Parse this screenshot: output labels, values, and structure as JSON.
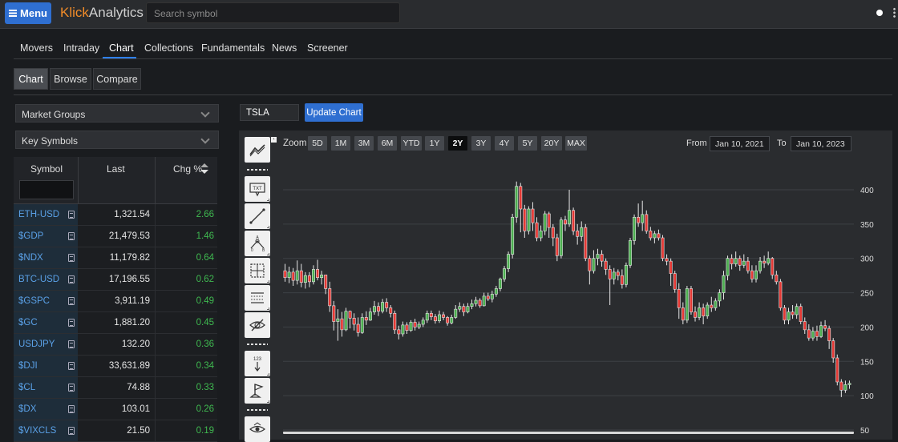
{
  "topbar": {
    "menu_label": "Menu",
    "logo_part1": "Klick",
    "logo_part2": "Analytics",
    "search_placeholder": "Search symbol"
  },
  "nav": {
    "tabs": [
      "Movers",
      "Intraday",
      "Chart",
      "Collections",
      "Fundamentals",
      "News",
      "Screener"
    ],
    "active": "Chart"
  },
  "subtabs": {
    "items": [
      "Chart",
      "Browse",
      "Compare"
    ],
    "active": "Chart"
  },
  "sidebar": {
    "market_groups": "Market Groups",
    "key_symbols": "Key Symbols",
    "columns": {
      "symbol": "Symbol",
      "last": "Last",
      "chg": "Chg %"
    },
    "rows": [
      {
        "symbol": "ETH-USD",
        "last": "1,321.54",
        "chg": "2.66"
      },
      {
        "symbol": "$GDP",
        "last": "21,479.53",
        "chg": "1.46"
      },
      {
        "symbol": "$NDX",
        "last": "11,179.82",
        "chg": "0.64"
      },
      {
        "symbol": "BTC-USD",
        "last": "17,196.55",
        "chg": "0.62"
      },
      {
        "symbol": "$GSPC",
        "last": "3,911.19",
        "chg": "0.49"
      },
      {
        "symbol": "$GC",
        "last": "1,881.20",
        "chg": "0.45"
      },
      {
        "symbol": "USDJPY",
        "last": "132.20",
        "chg": "0.36"
      },
      {
        "symbol": "$DJI",
        "last": "33,631.89",
        "chg": "0.34"
      },
      {
        "symbol": "$CL",
        "last": "74.88",
        "chg": "0.33"
      },
      {
        "symbol": "$DX",
        "last": "103.01",
        "chg": "0.26"
      },
      {
        "symbol": "$VIXCLS",
        "last": "21.50",
        "chg": "0.19"
      }
    ],
    "positive_color": "#3fb950"
  },
  "chart_controls": {
    "ticker": "TSLA",
    "update_label": "Update Chart",
    "zoom_label": "Zoom",
    "zoom_options": [
      "5D",
      "1M",
      "3M",
      "6M",
      "YTD",
      "1Y",
      "2Y",
      "3Y",
      "4Y",
      "5Y",
      "20Y",
      "MAX"
    ],
    "zoom_active": "2Y",
    "from_label": "From",
    "from_date": "Jan 10, 2021",
    "to_label": "To",
    "to_date": "Jan 10, 2023"
  },
  "tools": [
    "chart-style-icon",
    "text-annotation-icon",
    "trend-line-icon",
    "abcd-pattern-icon",
    "crosshair-box-icon",
    "fibonacci-icon",
    "hide-drawings-icon",
    "price-label-icon",
    "flag-marker-icon",
    "eye-pan-icon"
  ],
  "chart_data": {
    "type": "candlestick",
    "symbol": "TSLA",
    "ylim": [
      50,
      420
    ],
    "yticks": [
      400,
      350,
      300,
      250,
      200,
      150,
      100,
      50
    ],
    "up_color": "#4caf50",
    "down_color": "#e53935",
    "candles": [
      [
        282,
        272,
        292,
        266
      ],
      [
        272,
        280,
        288,
        264
      ],
      [
        280,
        268,
        286,
        260
      ],
      [
        268,
        282,
        297,
        262
      ],
      [
        282,
        265,
        292,
        258
      ],
      [
        265,
        275,
        280,
        256
      ],
      [
        275,
        266,
        280,
        258
      ],
      [
        266,
        284,
        290,
        262
      ],
      [
        284,
        272,
        298,
        268
      ],
      [
        272,
        276,
        282,
        262
      ],
      [
        276,
        256,
        274,
        248
      ],
      [
        256,
        231,
        266,
        222
      ],
      [
        231,
        208,
        238,
        195
      ],
      [
        208,
        212,
        226,
        180
      ],
      [
        212,
        196,
        222,
        186
      ],
      [
        196,
        223,
        228,
        194
      ],
      [
        223,
        213,
        224,
        198
      ],
      [
        213,
        204,
        220,
        195
      ],
      [
        204,
        192,
        214,
        186
      ],
      [
        192,
        214,
        220,
        190
      ],
      [
        214,
        210,
        223,
        203
      ],
      [
        210,
        222,
        228,
        209
      ],
      [
        222,
        230,
        238,
        218
      ],
      [
        230,
        223,
        236,
        216
      ],
      [
        223,
        236,
        241,
        220
      ],
      [
        236,
        228,
        242,
        222
      ],
      [
        228,
        220,
        232,
        214
      ],
      [
        220,
        196,
        224,
        190
      ],
      [
        196,
        190,
        202,
        182
      ],
      [
        190,
        203,
        208,
        186
      ],
      [
        203,
        195,
        207,
        190
      ],
      [
        195,
        207,
        210,
        193
      ],
      [
        207,
        200,
        212,
        195
      ],
      [
        200,
        204,
        208,
        197
      ],
      [
        204,
        210,
        214,
        200
      ],
      [
        210,
        220,
        224,
        206
      ],
      [
        220,
        215,
        224,
        210
      ],
      [
        215,
        209,
        219,
        205
      ],
      [
        209,
        218,
        224,
        206
      ],
      [
        218,
        214,
        222,
        210
      ],
      [
        214,
        206,
        216,
        202
      ],
      [
        206,
        214,
        218,
        204
      ],
      [
        214,
        226,
        232,
        212
      ],
      [
        226,
        230,
        236,
        222
      ],
      [
        230,
        222,
        234,
        216
      ],
      [
        222,
        230,
        235,
        220
      ],
      [
        230,
        234,
        240,
        226
      ],
      [
        234,
        239,
        244,
        230
      ],
      [
        239,
        231,
        242,
        228
      ],
      [
        231,
        245,
        250,
        230
      ],
      [
        245,
        241,
        250,
        238
      ],
      [
        241,
        248,
        253,
        236
      ],
      [
        248,
        256,
        260,
        244
      ],
      [
        256,
        270,
        272,
        252
      ],
      [
        270,
        285,
        289,
        266
      ],
      [
        285,
        306,
        310,
        280
      ],
      [
        306,
        360,
        365,
        300
      ],
      [
        360,
        405,
        412,
        352
      ],
      [
        405,
        372,
        410,
        338
      ],
      [
        372,
        340,
        378,
        330
      ],
      [
        340,
        372,
        376,
        335
      ],
      [
        372,
        352,
        382,
        340
      ],
      [
        352,
        330,
        360,
        325
      ],
      [
        330,
        340,
        348,
        325
      ],
      [
        340,
        365,
        369,
        334
      ],
      [
        365,
        345,
        368,
        330
      ],
      [
        345,
        330,
        350,
        318
      ],
      [
        330,
        304,
        336,
        296
      ],
      [
        304,
        356,
        360,
        300
      ],
      [
        356,
        350,
        362,
        340
      ],
      [
        350,
        370,
        400,
        346
      ],
      [
        370,
        340,
        374,
        334
      ],
      [
        340,
        332,
        350,
        320
      ],
      [
        332,
        345,
        354,
        325
      ],
      [
        345,
        300,
        350,
        296
      ],
      [
        300,
        282,
        304,
        262
      ],
      [
        282,
        300,
        312,
        278
      ],
      [
        300,
        306,
        314,
        290
      ],
      [
        306,
        296,
        312,
        288
      ],
      [
        296,
        284,
        300,
        276
      ],
      [
        284,
        270,
        290,
        232
      ],
      [
        270,
        280,
        286,
        262
      ],
      [
        280,
        275,
        284,
        268
      ],
      [
        275,
        262,
        284,
        256
      ],
      [
        262,
        290,
        294,
        258
      ],
      [
        290,
        326,
        330,
        286
      ],
      [
        326,
        360,
        364,
        320
      ],
      [
        360,
        352,
        380,
        346
      ],
      [
        352,
        364,
        384,
        340
      ],
      [
        364,
        340,
        370,
        336
      ],
      [
        340,
        330,
        346,
        326
      ],
      [
        330,
        336,
        340,
        322
      ],
      [
        336,
        330,
        342,
        326
      ],
      [
        330,
        300,
        334,
        296
      ],
      [
        300,
        296,
        306,
        290
      ],
      [
        296,
        278,
        300,
        260
      ],
      [
        278,
        255,
        282,
        250
      ],
      [
        255,
        228,
        264,
        212
      ],
      [
        228,
        210,
        236,
        204
      ],
      [
        210,
        256,
        260,
        206
      ],
      [
        256,
        222,
        260,
        218
      ],
      [
        222,
        214,
        230,
        208
      ],
      [
        214,
        228,
        236,
        210
      ],
      [
        228,
        216,
        234,
        204
      ],
      [
        216,
        232,
        236,
        212
      ],
      [
        232,
        228,
        244,
        222
      ],
      [
        228,
        238,
        242,
        224
      ],
      [
        238,
        250,
        255,
        230
      ],
      [
        250,
        275,
        282,
        240
      ],
      [
        275,
        300,
        304,
        268
      ],
      [
        300,
        292,
        306,
        284
      ],
      [
        292,
        300,
        310,
        288
      ],
      [
        300,
        290,
        304,
        282
      ],
      [
        290,
        296,
        306,
        286
      ],
      [
        296,
        282,
        302,
        278
      ],
      [
        282,
        270,
        290,
        265
      ],
      [
        270,
        282,
        290,
        265
      ],
      [
        282,
        296,
        302,
        278
      ],
      [
        296,
        293,
        304,
        286
      ],
      [
        293,
        300,
        310,
        290
      ],
      [
        300,
        276,
        302,
        270
      ],
      [
        276,
        266,
        282,
        262
      ],
      [
        266,
        228,
        270,
        224
      ],
      [
        228,
        210,
        232,
        204
      ],
      [
        210,
        222,
        228,
        204
      ],
      [
        222,
        218,
        232,
        212
      ],
      [
        218,
        230,
        234,
        212
      ],
      [
        230,
        208,
        234,
        204
      ],
      [
        208,
        196,
        214,
        190
      ],
      [
        196,
        184,
        204,
        180
      ],
      [
        184,
        194,
        200,
        180
      ],
      [
        194,
        186,
        202,
        180
      ],
      [
        186,
        202,
        208,
        184
      ],
      [
        202,
        198,
        210,
        194
      ],
      [
        198,
        180,
        202,
        168
      ],
      [
        180,
        155,
        184,
        148
      ],
      [
        155,
        120,
        160,
        115
      ],
      [
        120,
        108,
        124,
        98
      ],
      [
        108,
        116,
        122,
        104
      ],
      [
        116,
        118,
        122,
        110
      ]
    ]
  }
}
